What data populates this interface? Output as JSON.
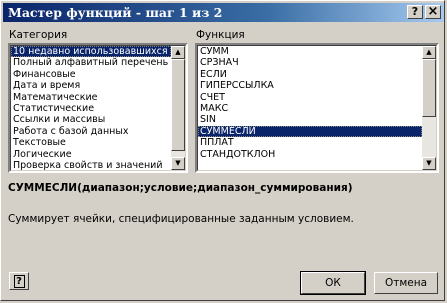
{
  "window": {
    "title": "Мастер функций - шаг 1 из 2",
    "help_button": "?",
    "close_button": "×"
  },
  "category": {
    "label": "Категория",
    "items": [
      "10 недавно использовавшихся",
      "Полный алфавитный перечень",
      "Финансовые",
      "Дата и время",
      "Математические",
      "Статистические",
      "Ссылки и массивы",
      "Работа с базой данных",
      "Текстовые",
      "Логические",
      "Проверка свойств и значений"
    ],
    "selected_index": 0
  },
  "functions": {
    "label": "Функция",
    "items": [
      "СУММ",
      "СРЗНАЧ",
      "ЕСЛИ",
      "ГИПЕРССЫЛКА",
      "СЧЁТ",
      "МАКС",
      "SIN",
      "СУММЕСЛИ",
      "ППЛАТ",
      "СТАНДОТКЛОН"
    ],
    "selected_index": 7
  },
  "signature": "СУММЕСЛИ(диапазон;условие;диапазон_суммирования)",
  "description": "Суммирует ячейки, специфицированные заданным условием.",
  "buttons": {
    "help_icon": "?",
    "ok": "ОК",
    "cancel": "Отмена"
  }
}
